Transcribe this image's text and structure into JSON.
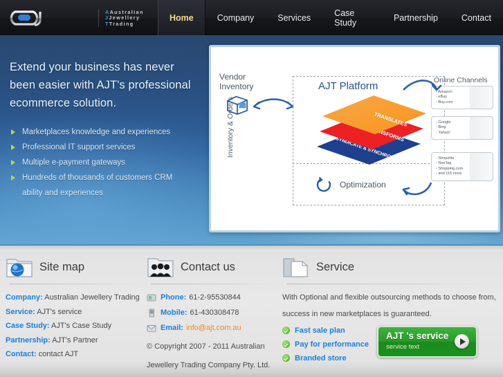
{
  "header": {
    "logo": {
      "mark_text": "ajt",
      "line1": "Australian",
      "line2": "Jewellery",
      "line3": "Trading"
    },
    "nav": [
      {
        "label": "Home",
        "active": true
      },
      {
        "label": "Company",
        "active": false
      },
      {
        "label": "Services",
        "active": false
      },
      {
        "label": "Case Study",
        "active": false
      },
      {
        "label": "Partnership",
        "active": false
      },
      {
        "label": "Contact",
        "active": false
      }
    ]
  },
  "banner": {
    "headline": "Extend your business has never been easier with AJT's professional ecommerce solution.",
    "bullets": [
      "Marketplaces knowledge and experiences",
      "Professional IT support services",
      "Multiple e-payment gateways",
      "Hundreds of thousands of customers CRM"
    ],
    "bullet_continuation": "ability and experiences"
  },
  "diagram": {
    "vendor_label_line1": "Vendor",
    "vendor_label_line2": "Inventory",
    "platform_title": "AJT Platform",
    "side_label": "Inventory & Orders",
    "layers": [
      {
        "name": "TRANSLATES",
        "color": "#f7941d"
      },
      {
        "name": "TRANSFORMS",
        "color": "#ed2024"
      },
      {
        "name": "SYNDICATE & SYNCHRONIZE",
        "color": "#1f3f8f"
      }
    ],
    "optimization_label": "Optimization",
    "channels_label": "Online Channels",
    "channel_boxes": [
      [
        "- Amazon",
        "- eBay",
        "- Buy.com"
      ],
      [
        "- Google",
        "- Bing",
        "- Yahoo!"
      ],
      [
        "- Shopzilla",
        "- NexTag",
        "- Shopping.com",
        "- and 115 more"
      ]
    ]
  },
  "footer": {
    "sitemap": {
      "title": "Site map",
      "icon": "globe-folder-icon",
      "rows": [
        {
          "label": "Company:",
          "value": " Australian Jewellery Trading"
        },
        {
          "label": "Service:",
          "value": " AJT's service"
        },
        {
          "label": "Case Study:",
          "value": " AJT's Case Study"
        },
        {
          "label": "Partnership:",
          "value": " AJT's Partner"
        },
        {
          "label": "Contact:",
          "value": " contact AJT"
        }
      ]
    },
    "contact": {
      "title": "Contact us",
      "icon": "people-folder-icon",
      "phone_label": "Phone:",
      "phone_value": "61-2-95530844",
      "mobile_label": "Mobile:",
      "mobile_value": "61-430308478",
      "email_label": "Email:",
      "email_value": "info@ajt.com.au",
      "copyright_line1": "© Copyright 2007 - 2011 Australian",
      "copyright_line2": "Jewellery Trading Company Pty. Ltd."
    },
    "service": {
      "title": "Service",
      "icon": "documents-folder-icon",
      "paragraph_line1": "With Optional and flexible outsourcing methods to choose from,",
      "paragraph_line2": "success in new marketplaces is guaranteed.",
      "items": [
        "Fast sale plan",
        "Pay for performance",
        "Branded store"
      ],
      "button_title": "AJT 's service",
      "button_subtitle": "service text"
    }
  },
  "colors": {
    "accent_blue": "#1b7fe0",
    "email_orange": "#f08a24",
    "nav_active": "#f3d98a",
    "button_green": "#2a9a2a",
    "bullet_green": "#b5d943"
  }
}
